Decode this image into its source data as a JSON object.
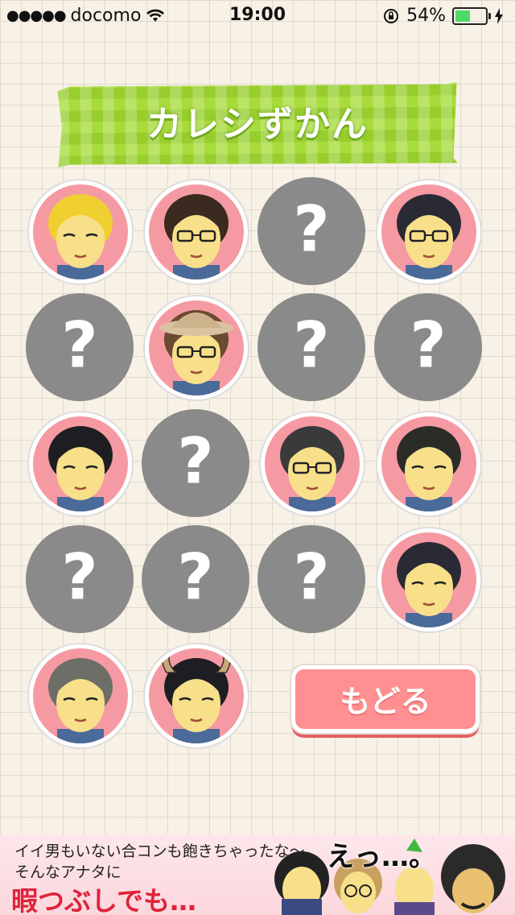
{
  "status_bar": {
    "carrier": "docomo",
    "time": "19:00",
    "battery_percent": "54%",
    "battery_level": 0.54,
    "icons": [
      "signal-dots-icon",
      "wifi-icon",
      "orientation-lock-icon",
      "battery-icon",
      "charging-bolt-icon"
    ]
  },
  "title": "カレシずかん",
  "grid": {
    "locked_symbol": "?",
    "items": [
      {
        "state": "unlocked",
        "character": "blond-hair-man"
      },
      {
        "state": "unlocked",
        "character": "curly-hair-glasses-man"
      },
      {
        "state": "locked"
      },
      {
        "state": "unlocked",
        "character": "long-hair-glasses-man"
      },
      {
        "state": "locked"
      },
      {
        "state": "unlocked",
        "character": "explorer-hat-glasses-man"
      },
      {
        "state": "locked"
      },
      {
        "state": "locked"
      },
      {
        "state": "unlocked",
        "character": "black-hair-man"
      },
      {
        "state": "locked"
      },
      {
        "state": "unlocked",
        "character": "bowl-cut-glasses-man"
      },
      {
        "state": "unlocked",
        "character": "chubby-man"
      },
      {
        "state": "locked"
      },
      {
        "state": "locked"
      },
      {
        "state": "locked"
      },
      {
        "state": "unlocked",
        "character": "pompadour-man"
      },
      {
        "state": "unlocked",
        "character": "gray-hair-man"
      },
      {
        "state": "unlocked",
        "character": "horned-devil-man"
      }
    ]
  },
  "back_button_label": "もどる",
  "ad": {
    "line1": "イイ男もいない合コンも飽きちゃったな～",
    "line2": "そんなアナタに",
    "headline": "暇つぶしでも…",
    "speech": "えっ…。"
  },
  "colors": {
    "accent_green": "#a8dc3c",
    "avatar_pink": "#f59aa2",
    "locked_gray": "#8a8a8a",
    "button_pink": "#ff8f90",
    "ad_red": "#e0233a"
  }
}
